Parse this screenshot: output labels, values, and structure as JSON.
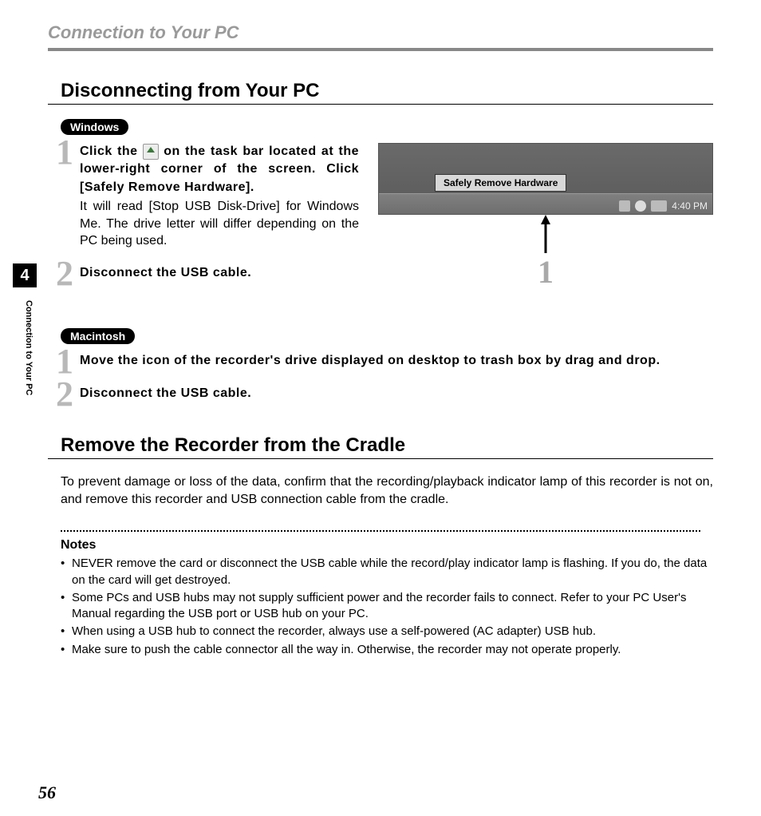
{
  "header": {
    "section": "Connection to Your PC"
  },
  "disconnect": {
    "title": "Disconnecting from Your PC",
    "windows": {
      "pill": "Windows",
      "step1": {
        "n": "1",
        "bold_pre": "Click the ",
        "bold_post": " on the task bar located at the lower-right corner of the screen. Click [Safely Remove Hardware].",
        "body": "It will read [Stop USB Disk-Drive] for Windows Me. The drive letter will differ depending on the PC being used."
      },
      "step2": {
        "n": "2",
        "bold": "Disconnect the USB cable."
      },
      "screenshot": {
        "tooltip": "Safely Remove Hardware",
        "time": "4:40 PM",
        "callout": "1"
      }
    },
    "mac": {
      "pill": "Macintosh",
      "step1": {
        "n": "1",
        "bold": "Move the icon of the recorder's drive displayed on desktop to trash box by drag and drop."
      },
      "step2": {
        "n": "2",
        "bold": "Disconnect the USB cable."
      }
    }
  },
  "remove": {
    "title": "Remove the Recorder from the Cradle",
    "body": "To prevent damage or loss of the data, confirm that the recording/playback indicator lamp of this recorder is not on, and remove this recorder and USB connection cable from the cradle."
  },
  "notes": {
    "title": "Notes",
    "items": [
      "NEVER remove the card or disconnect the USB cable while the record/play indicator lamp is flashing. If you do, the data on the card will get destroyed.",
      "Some PCs and USB hubs may not supply sufficient power and the recorder fails to connect. Refer to your PC User's Manual regarding the USB port or USB hub on your PC.",
      "When using a USB hub to connect the recorder, always use a self-powered (AC adapter) USB hub.",
      "Make sure to push the cable connector all the way in. Otherwise, the recorder may not operate properly."
    ]
  },
  "sidebar": {
    "tab": "4",
    "label": "Connection to Your PC"
  },
  "page": "56"
}
